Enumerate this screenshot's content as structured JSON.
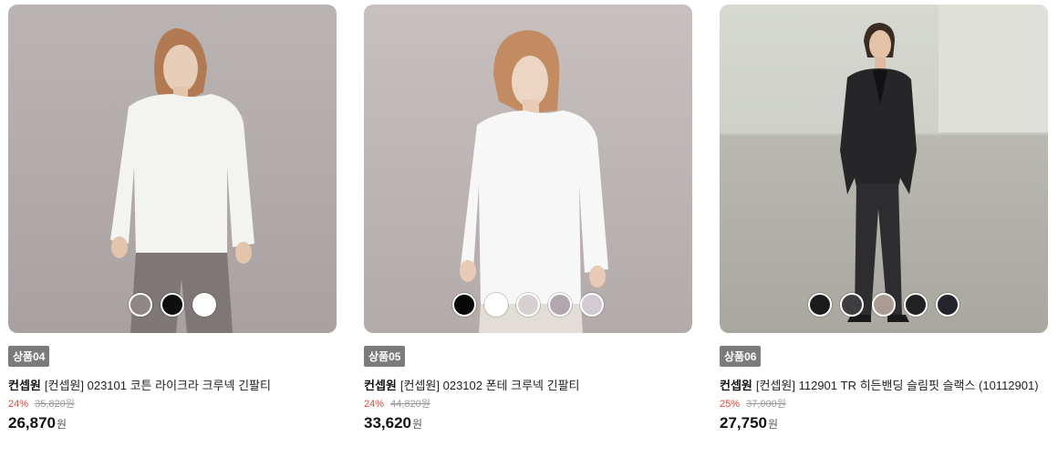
{
  "products": [
    {
      "badge": "상품04",
      "brand": "컨셉원",
      "name": "[컨셉원] 023101 코튼 라이크라 크루넥 긴팔티",
      "discount_rate": "24%",
      "original_price": "35,820원",
      "sale_price": "26,870",
      "currency": "원",
      "swatches": [
        "#8f8784",
        "#0e0e0e",
        "#ffffff"
      ]
    },
    {
      "badge": "상품05",
      "brand": "컨셉원",
      "name": "[컨셉원] 023102 폰테 크루넥 긴팔티",
      "discount_rate": "24%",
      "original_price": "44,820원",
      "sale_price": "33,620",
      "currency": "원",
      "swatches": [
        "#080808",
        "#ffffff",
        "#d8d0d0",
        "#b2a7ae",
        "#d2cbd6"
      ]
    },
    {
      "badge": "상품06",
      "brand": "컨셉원",
      "name": "[컨셉원] 112901 TR 히든밴딩 슬림핏 슬랙스 (10112901)",
      "discount_rate": "25%",
      "original_price": "37,000원",
      "sale_price": "27,750",
      "currency": "원",
      "swatches": [
        "#1b1b1d",
        "#3e3e40",
        "#ab9b93",
        "#222224",
        "#24252c"
      ]
    }
  ]
}
